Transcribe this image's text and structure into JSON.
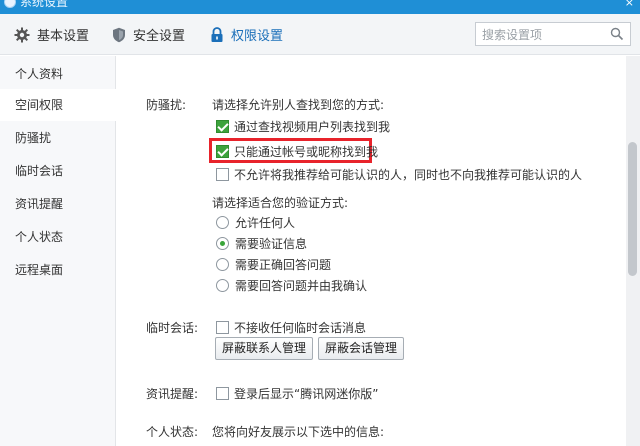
{
  "window": {
    "title": "系统设置",
    "close_glyph": "×"
  },
  "tabs": [
    {
      "label": "基本设置",
      "icon": "gear-icon"
    },
    {
      "label": "安全设置",
      "icon": "shield-icon"
    },
    {
      "label": "权限设置",
      "icon": "lock-icon"
    }
  ],
  "active_tab": "权限设置",
  "search": {
    "placeholder": "搜索设置项",
    "value": ""
  },
  "sidebar": {
    "items": [
      {
        "label": "个人资料"
      },
      {
        "label": "空间权限"
      },
      {
        "label": "防骚扰"
      },
      {
        "label": "临时会话"
      },
      {
        "label": "资讯提醒"
      },
      {
        "label": "个人状态"
      },
      {
        "label": "远程桌面"
      }
    ],
    "active": "空间权限"
  },
  "anti_harass": {
    "label": "防骚扰:",
    "find_prompt": "请选择允许别人查找到您的方式:",
    "find_options": [
      {
        "label": "通过查找视频用户列表找到我",
        "checked": true
      },
      {
        "label": "只能通过帐号或昵称找到我",
        "checked": true,
        "highlighted": true
      },
      {
        "label": "不允许将我推荐给可能认识的人，同时也不向我推荐可能认识的人",
        "checked": false
      }
    ],
    "verify_prompt": "请选择适合您的验证方式:",
    "verify_options": [
      {
        "label": "允许任何人",
        "selected": false
      },
      {
        "label": "需要验证信息",
        "selected": true
      },
      {
        "label": "需要正确回答问题",
        "selected": false
      },
      {
        "label": "需要回答问题并由我确认",
        "selected": false
      }
    ]
  },
  "temp_session": {
    "label": "临时会话:",
    "option": {
      "label": "不接收任何临时会话消息",
      "checked": false
    },
    "buttons": {
      "block_contacts": "屏蔽联系人管理",
      "block_sessions": "屏蔽会话管理"
    }
  },
  "news_reminder": {
    "label": "资讯提醒:",
    "option": {
      "label": "登录后显示“腾讯网迷你版”",
      "checked": false
    }
  },
  "personal_status": {
    "label": "个人状态:",
    "prompt": "您将向好友展示以下选中的信息:"
  },
  "colors": {
    "titlebar": "#1f8fd6",
    "accent": "#1b6fb9",
    "check_green": "#3da33d",
    "highlight_red": "#e8232b"
  }
}
